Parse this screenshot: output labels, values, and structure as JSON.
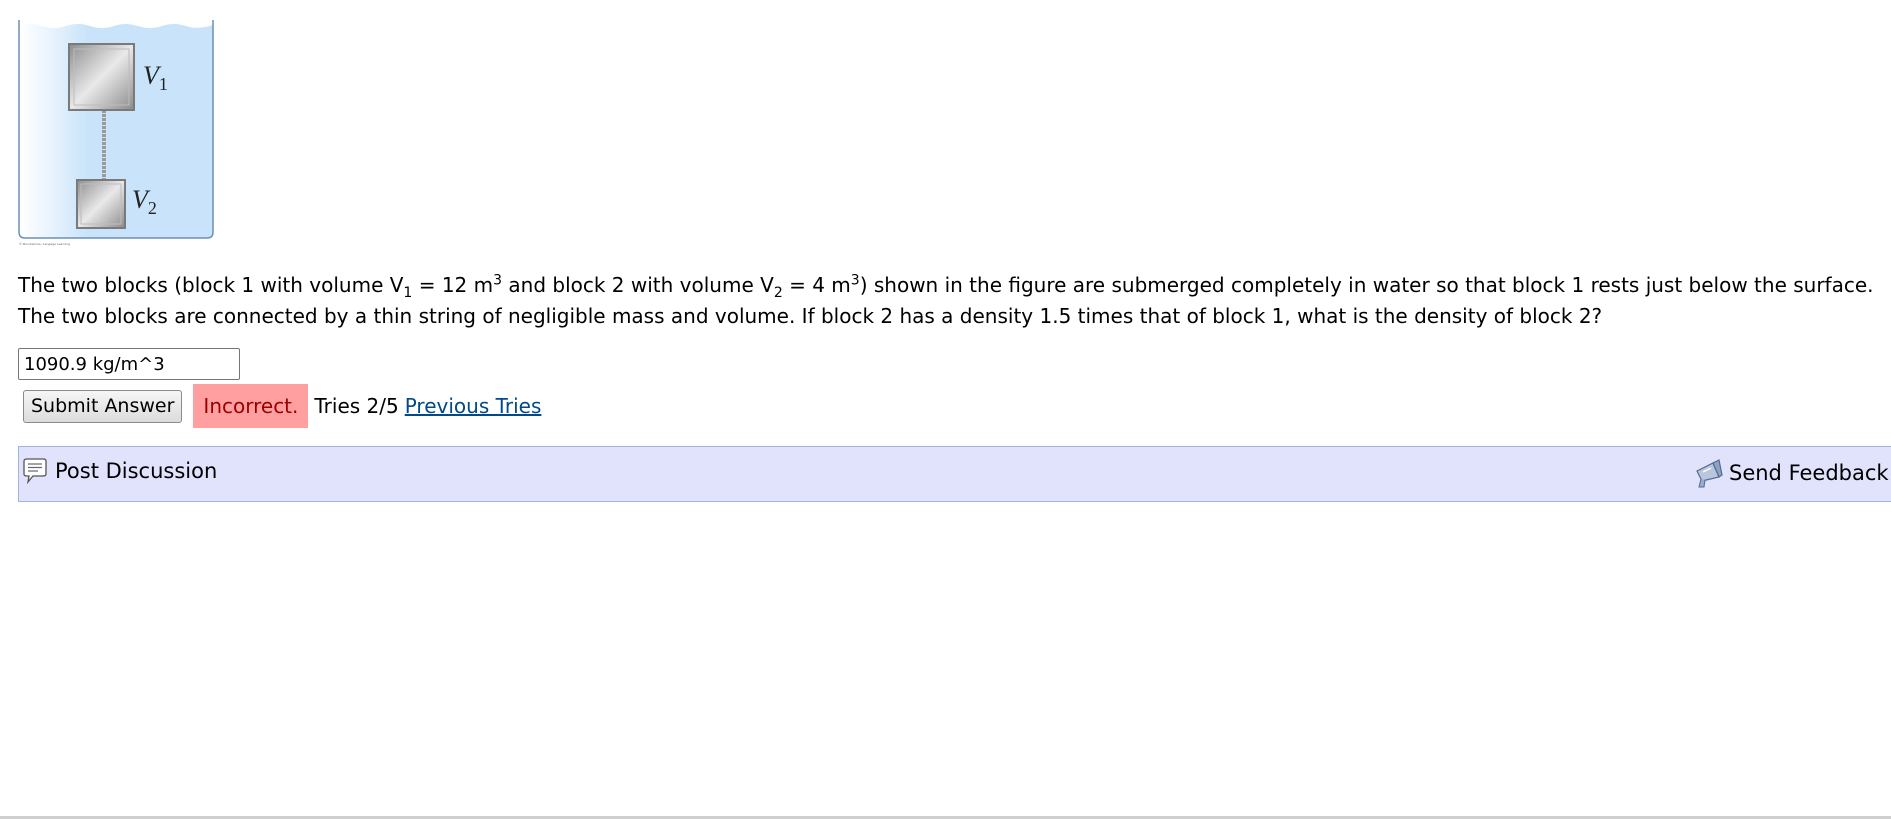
{
  "figure": {
    "label_v1_main": "V",
    "label_v1_sub": "1",
    "label_v2_main": "V",
    "label_v2_sub": "2",
    "copyright": "© Brooks/Cole, Cengage Learning"
  },
  "question": {
    "line1_a": "The two blocks (block 1 with volume V",
    "line1_sub1": "1",
    "line1_b": " = 12 m",
    "line1_sup1": "3",
    "line1_c": " and block 2 with volume V",
    "line1_sub2": "2",
    "line1_d": " = 4 m",
    "line1_sup2": "3",
    "line1_e": ") shown in the figure are submerged completely in water so that block 1 rests just below the surface.",
    "line2": "The two blocks are connected by a thin string of negligible mass and volume. If block 2 has a density 1.5 times that of block 1, what is the density of block 2?"
  },
  "answer": {
    "value": "1090.9 kg/m^3"
  },
  "submit": {
    "button_label": "Submit Answer",
    "status": "Incorrect.",
    "tries": "Tries 2/5",
    "previous_tries": "Previous Tries"
  },
  "discussion": {
    "post_label": "Post Discussion",
    "feedback_label": "Send Feedback"
  },
  "colors": {
    "water": "#c9e4fa",
    "incorrect_bg": "#ff9f9f",
    "discussion_bg": "#e0e3fb",
    "link": "#00498a"
  }
}
